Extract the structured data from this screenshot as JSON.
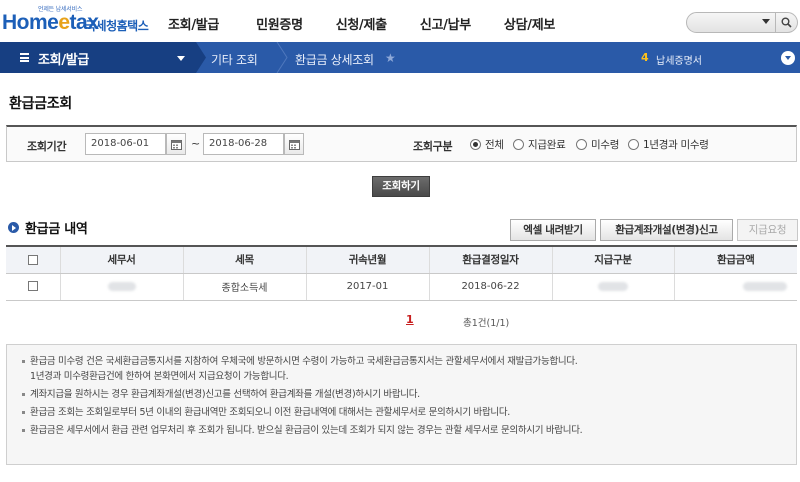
{
  "header": {
    "logo": {
      "tagline": "언제든 납세서비스",
      "brand_main": "Home",
      "brand_e": "e",
      "brand_tail": "tax",
      "brand_kr": "국세청홈택스"
    },
    "nav": [
      "조회/발급",
      "민원증명",
      "신청/제출",
      "신고/납부",
      "상담/제보"
    ],
    "search": {
      "icon": "search-icon"
    }
  },
  "location_bar": {
    "menu": "조회/발급",
    "crumbs": [
      "기타 조회",
      "환급금 상세조회"
    ],
    "count": "4",
    "count_label": "납세증명서"
  },
  "page": {
    "title": "환급금조회"
  },
  "search_panel": {
    "period_label": "조회기간",
    "start_date": "2018-06-01",
    "tilde": "~",
    "end_date": "2018-06-28",
    "kind_label": "조회구분",
    "options": [
      {
        "label": "전체",
        "selected": true
      },
      {
        "label": "지급완료",
        "selected": false
      },
      {
        "label": "미수령",
        "selected": false
      },
      {
        "label": "1년경과 미수령",
        "selected": false
      }
    ],
    "query_button": "조회하기"
  },
  "list": {
    "title": "환급금 내역",
    "buttons": {
      "excel": "엑셀 내려받기",
      "account": "환급계좌개설(변경)신고",
      "request": "지급요청"
    },
    "columns": [
      "세무서",
      "세목",
      "귀속년월",
      "환급결정일자",
      "지급구분",
      "환급금액"
    ],
    "rows": [
      {
        "office": "",
        "tax_item": "종합소득세",
        "period": "2017-01",
        "decision_date": "2018-06-22",
        "pay_type": "",
        "amount": ""
      }
    ],
    "paging": {
      "current": "1",
      "total": "총1건(1/1)"
    }
  },
  "notice": {
    "lines": [
      "환급금 미수령 건은 국세환급금통지서를 지참하여 우체국에 방문하시면 수령이 가능하고 국세환급금통지서는 관할세무서에서 재발급가능합니다.",
      "1년경과 미수령환급건에 한하여 본화면에서 지급요청이 가능합니다.",
      "계좌지급을 원하시는 경우 환급계좌개설(변경)신고를 선택하여 환급계좌를 개설(변경)하시기 바랍니다.",
      "환급금 조회는 조회일로부터 5년 이내의 환급내역만 조회되오니 이전 환급내역에 대해서는 관할세무서로 문의하시기 바랍니다.",
      "환급금은 세무서에서 환급 관련 업무처리 후 조회가 됩니다. 받으실 환급금이 있는데 조회가 되지 않는 경우는 관할 세무서로 문의하시기 바랍니다."
    ]
  },
  "colors": {
    "brand_blue": "#1c5fb8",
    "locbar": "#2a5aa8",
    "locbar_dark": "#173f82",
    "accent_orange": "#e8a21a",
    "page_red": "#c81e1e"
  }
}
